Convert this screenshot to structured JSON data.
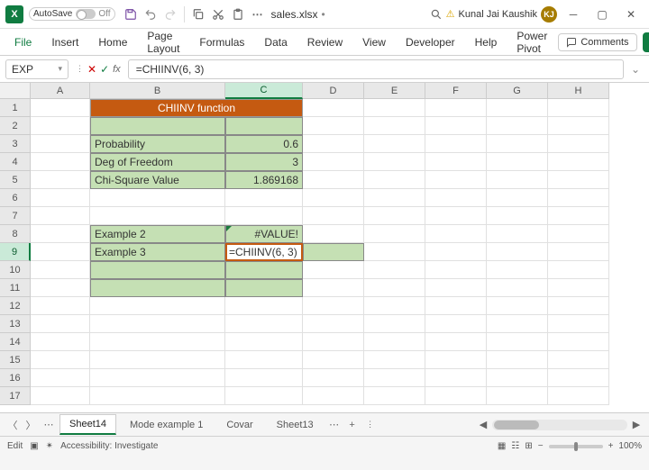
{
  "title": {
    "autosave": "AutoSave",
    "autosave_state": "Off",
    "filename": "sales.xlsx",
    "dot": "•",
    "user_name": "Kunal Jai Kaushik",
    "user_initials": "KJ"
  },
  "ribbon": {
    "tabs": [
      "File",
      "Insert",
      "Home",
      "Page Layout",
      "Formulas",
      "Data",
      "Review",
      "View",
      "Developer",
      "Help",
      "Power Pivot"
    ],
    "comments": "Comments"
  },
  "formula_bar": {
    "namebox": "EXP",
    "formula": "=CHIINV(6, 3)"
  },
  "columns": [
    "A",
    "B",
    "C",
    "D",
    "E",
    "F",
    "G",
    "H"
  ],
  "row_numbers": [
    "1",
    "2",
    "3",
    "4",
    "5",
    "6",
    "7",
    "8",
    "9",
    "10",
    "11",
    "12",
    "13",
    "14",
    "15",
    "16",
    "17"
  ],
  "cells": {
    "b1": "CHIINV function",
    "b3": "Probability",
    "c3": "0.6",
    "b4": "Deg of Freedom",
    "c4": "3",
    "b5": "Chi-Square Value",
    "c5": "1.869168",
    "b8": "Example 2",
    "c8": "#VALUE!",
    "b9": "Example 3",
    "c9": "=CHIINV(6, 3)"
  },
  "sheets": {
    "active": "Sheet14",
    "others": [
      "Mode example 1",
      "Covar",
      "Sheet13"
    ]
  },
  "status": {
    "mode": "Edit",
    "accessibility": "Accessibility: Investigate",
    "zoom": "100%"
  }
}
